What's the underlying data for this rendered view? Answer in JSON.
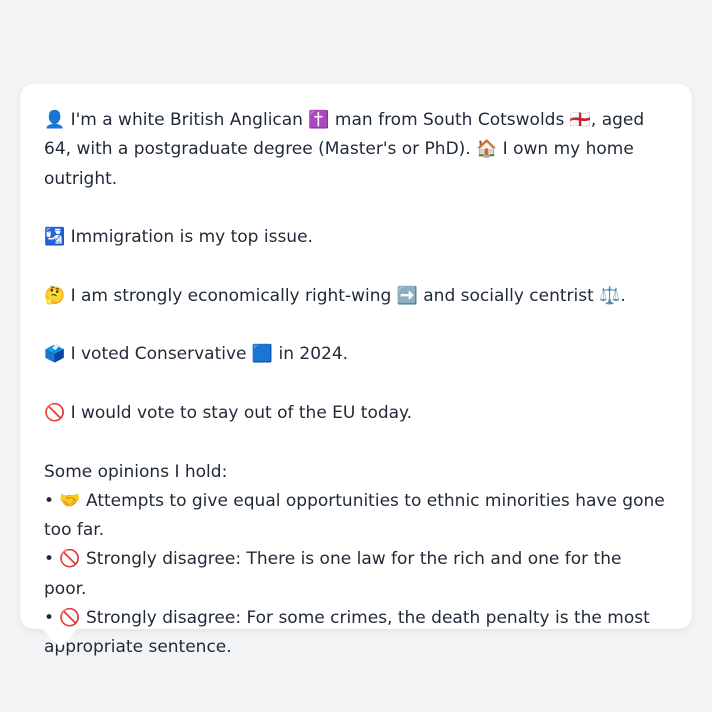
{
  "card": {
    "profile": "👤 I'm a white British Anglican ✝️ man from South Cotswolds 🏴󠁧󠁢󠁥󠁮󠁧󠁿, aged 64, with a postgraduate degree (Master's or PhD). 🏠 I own my home outright.",
    "top_issue": "🛂 Immigration is my top issue.",
    "ideology": "🤔 I am strongly economically right-wing ➡️ and socially centrist ⚖️.",
    "vote_2024": "🗳️ I voted Conservative 🟦 in 2024.",
    "eu": "🚫 I would vote to stay out of the EU today.",
    "opinions_heading": "Some opinions I hold:",
    "opinions": [
      "• 🤝 Attempts to give equal opportunities to ethnic minorities have gone too far.",
      "• 🚫 Strongly disagree: There is one law for the rich and one for the poor.",
      "• 🚫 Strongly disagree: For some crimes, the death penalty is the most appropriate sentence."
    ]
  }
}
